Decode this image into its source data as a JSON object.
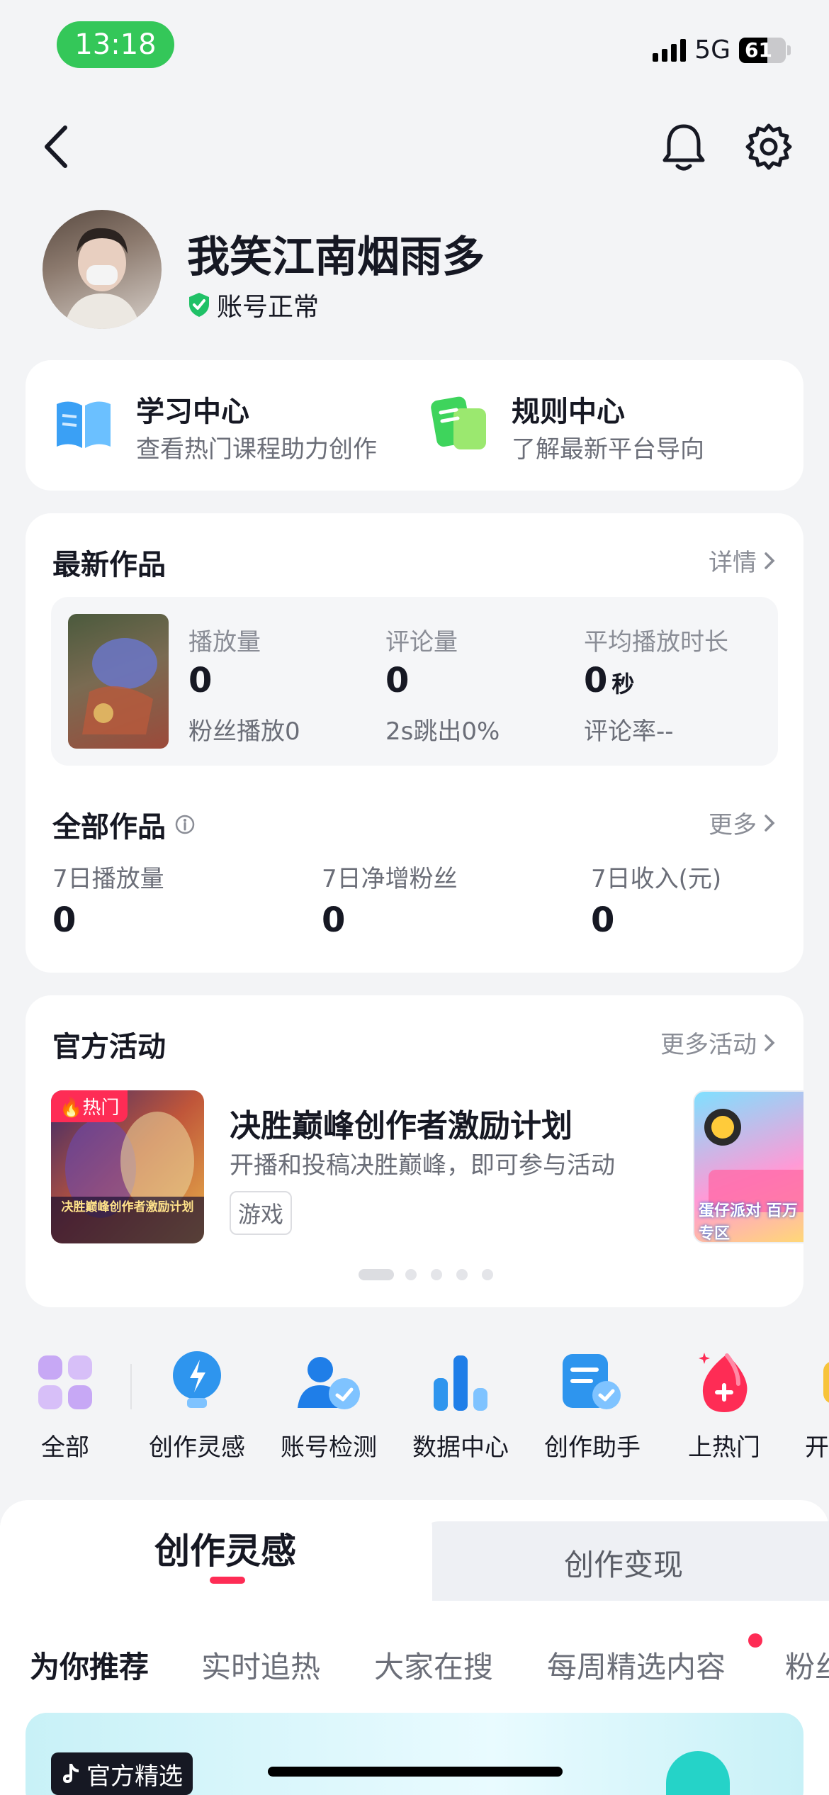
{
  "status_bar": {
    "time": "13:18",
    "network": "5G",
    "battery": "61",
    "battery_level": 0.61
  },
  "profile": {
    "name": "我笑江南烟雨多",
    "account_status": "账号正常"
  },
  "quick_links": [
    {
      "title": "学习中心",
      "subtitle": "查看热门课程助力创作",
      "icon": "book-icon"
    },
    {
      "title": "规则中心",
      "subtitle": "了解最新平台导向",
      "icon": "rules-icon"
    }
  ],
  "latest_works": {
    "title": "最新作品",
    "detail_link": "详情",
    "stats": [
      {
        "label": "播放量",
        "value": "0",
        "sub": "粉丝播放0"
      },
      {
        "label": "评论量",
        "value": "0",
        "sub": "2s跳出0%"
      },
      {
        "label": "平均播放时长",
        "value": "0",
        "unit": "秒",
        "sub": "评论率--"
      }
    ]
  },
  "all_works": {
    "title": "全部作品",
    "more_link": "更多",
    "stats": [
      {
        "label": "7日播放量",
        "value": "0"
      },
      {
        "label": "7日净增粉丝",
        "value": "0"
      },
      {
        "label": "7日收入(元)",
        "value": "0"
      }
    ]
  },
  "activities": {
    "title": "官方活动",
    "more_link": "更多活动",
    "items": [
      {
        "badge": "热门",
        "banner_text": "决胜巅峰创作者激励计划",
        "title": "决胜巅峰创作者激励计划",
        "desc": "开播和投稿决胜巅峰，即可参与活动",
        "tag": "游戏"
      },
      {
        "banner_text": "蛋仔派对 百万专区"
      }
    ],
    "page_count": 5,
    "active_page": 0
  },
  "tools": [
    {
      "label": "全部",
      "icon": "grid-icon"
    },
    {
      "label": "创作灵感",
      "icon": "lightbulb-icon"
    },
    {
      "label": "账号检测",
      "icon": "account-check-icon"
    },
    {
      "label": "数据中心",
      "icon": "bar-chart-icon"
    },
    {
      "label": "创作助手",
      "icon": "assistant-doc-icon"
    },
    {
      "label": "上热门",
      "icon": "hot-drop-icon"
    },
    {
      "label": "开",
      "icon": "bell-partial-icon"
    }
  ],
  "main_tabs": [
    {
      "label": "创作灵感",
      "active": true
    },
    {
      "label": "创作变现",
      "active": false
    }
  ],
  "sub_tabs": [
    {
      "label": "为你推荐",
      "active": true
    },
    {
      "label": "实时追热"
    },
    {
      "label": "大家在搜"
    },
    {
      "label": "每周精选内容",
      "has_dot": true
    },
    {
      "label": "粉丝"
    }
  ],
  "featured": {
    "badge": "官方精选"
  },
  "colors": {
    "accent": "#fe2c55",
    "verified": "#20c167",
    "status_green": "#34c759"
  }
}
